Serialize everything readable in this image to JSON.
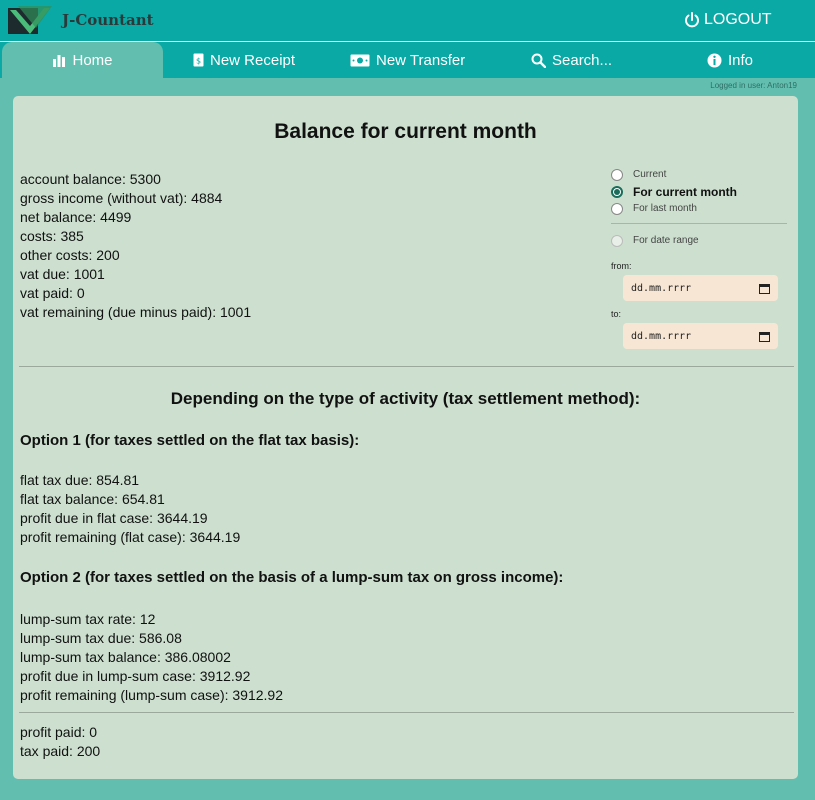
{
  "header": {
    "app_title": "J-Countant",
    "logout_label": "LOGOUT"
  },
  "nav": {
    "tabs": [
      {
        "label": "Home",
        "icon": "bar-chart-icon"
      },
      {
        "label": "New Receipt",
        "icon": "receipt-icon"
      },
      {
        "label": "New Transfer",
        "icon": "money-icon"
      },
      {
        "label": "Search...",
        "icon": "search-icon"
      },
      {
        "label": "Info",
        "icon": "info-icon"
      }
    ],
    "logged_in": "Logged in user: Anton19"
  },
  "main": {
    "title": "Balance for current month",
    "stats": [
      "account balance: 5300",
      "gross income (without vat): 4884",
      "net balance: 4499",
      "costs: 385",
      "other costs: 200",
      "vat due: 1001",
      "vat paid: 0",
      "vat remaining (due minus paid): 1001"
    ],
    "period": {
      "options": [
        "Current",
        "For current month",
        "For last month"
      ],
      "selected": "For current month",
      "range_label": "For date range",
      "from_label": "from:",
      "to_label": "to:",
      "from_placeholder": "dd.mm.rrrr",
      "to_placeholder": "dd.mm.rrrr"
    },
    "activity_title": "Depending on the type of activity (tax settlement method):",
    "option1": {
      "title": "Option 1 (for taxes settled on the flat tax basis):",
      "lines": [
        "flat tax due: 854.81",
        "flat tax balance: 654.81",
        "profit due in flat case: 3644.19",
        "profit remaining (flat case): 3644.19"
      ]
    },
    "option2": {
      "title": "Option 2 (for taxes settled on the basis of a lump-sum tax on gross income):",
      "lines": [
        "lump-sum tax rate: 12",
        "lump-sum tax due: 586.08",
        "lump-sum tax balance: 386.08002",
        "profit due in lump-sum case: 3912.92",
        "profit remaining (lump-sum case): 3912.92"
      ]
    },
    "paid": [
      "profit paid: 0",
      "tax paid: 200"
    ]
  }
}
